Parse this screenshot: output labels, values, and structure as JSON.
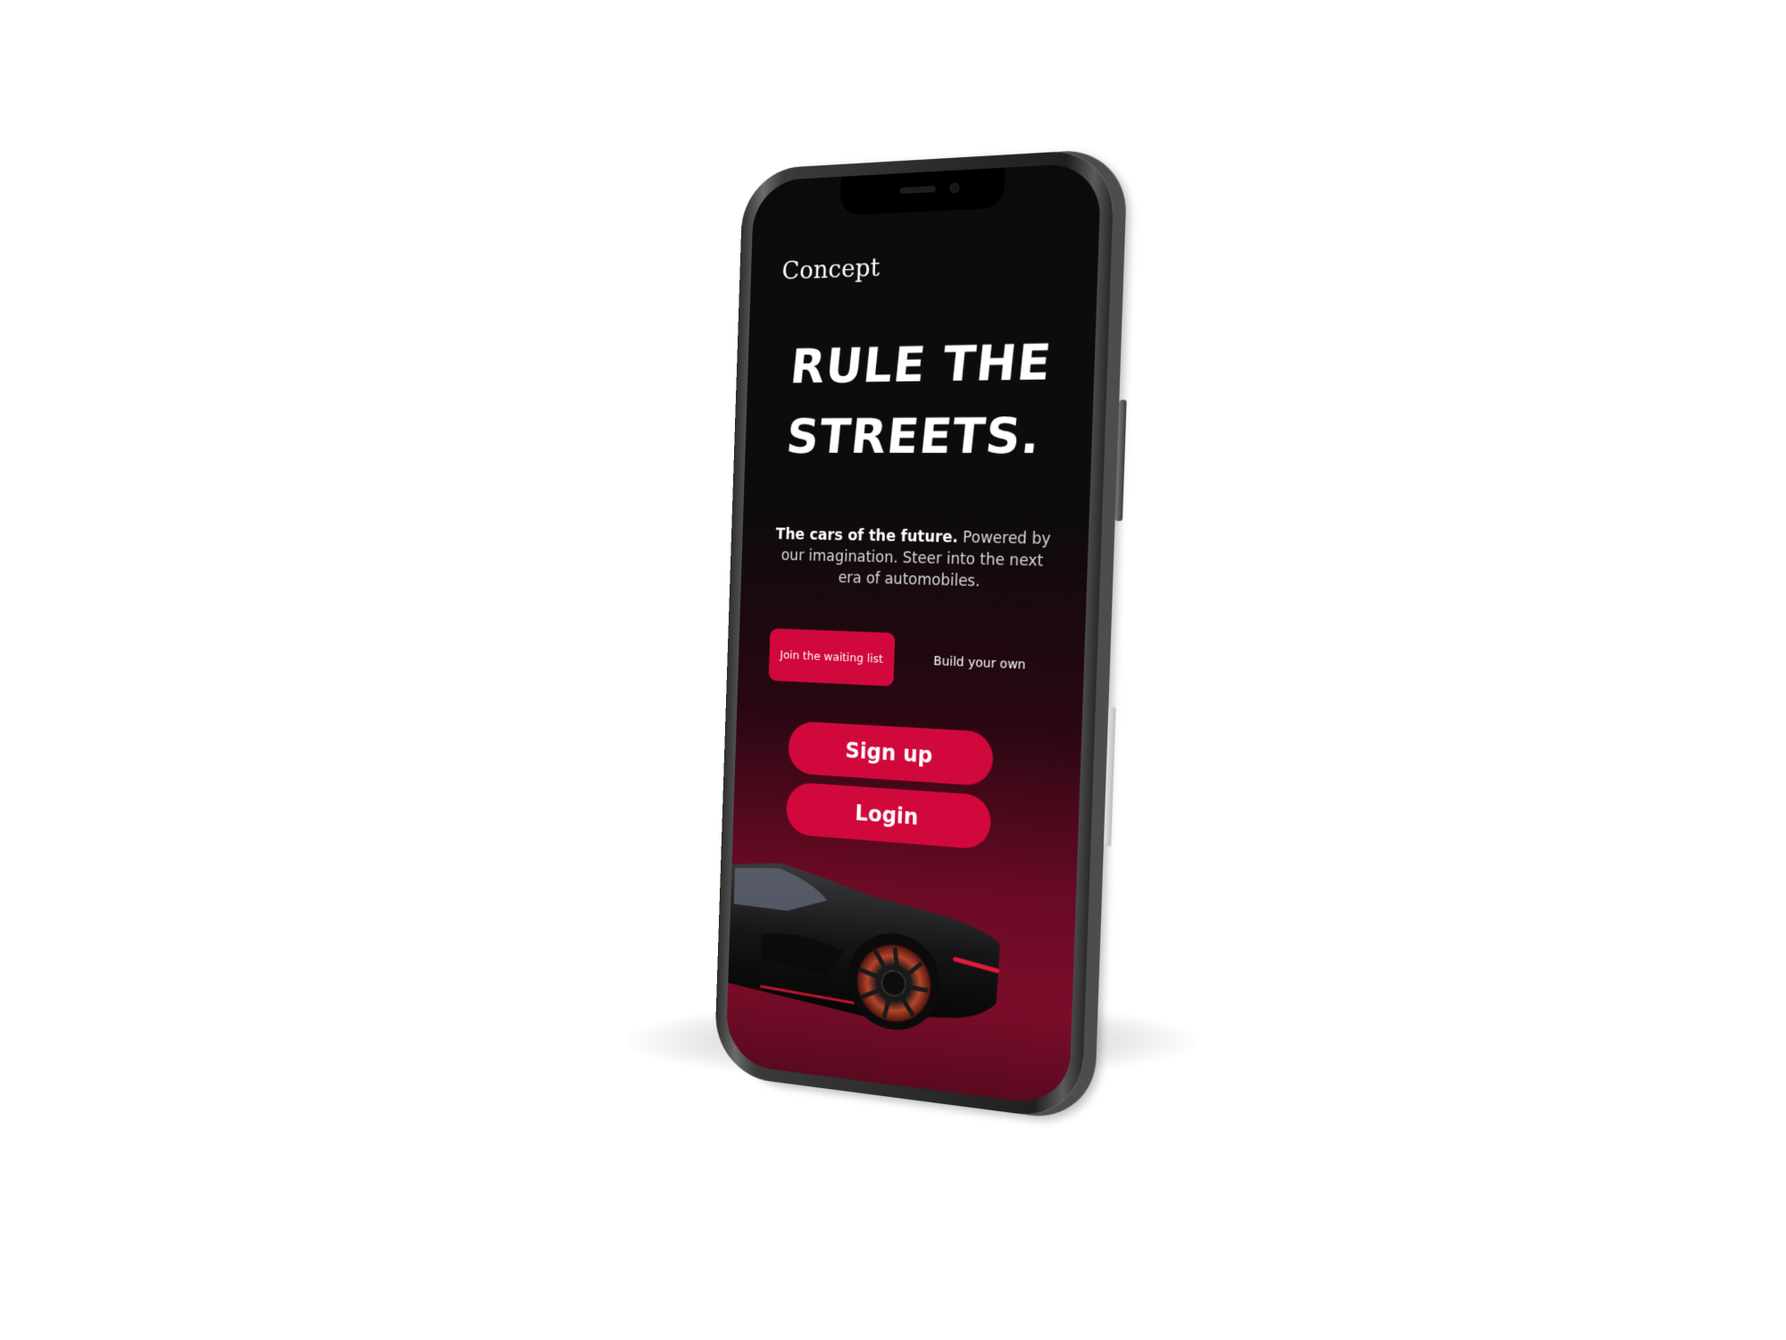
{
  "app": {
    "brand": "Concept"
  },
  "hero": {
    "headline_line1": "Rule the",
    "headline_line2": "streets.",
    "subtitle_bold": "The cars of the future.",
    "subtitle_rest": " Powered by our imagination. Steer into the next era of automobiles."
  },
  "actions": {
    "waitlist_label": "Join the waiting list",
    "build_label": "Build your own",
    "signup_label": "Sign up",
    "login_label": "Login"
  },
  "colors": {
    "accent": "#d1083b",
    "background_top": "#0b0b0d",
    "background_bottom": "#7a0c2a"
  }
}
